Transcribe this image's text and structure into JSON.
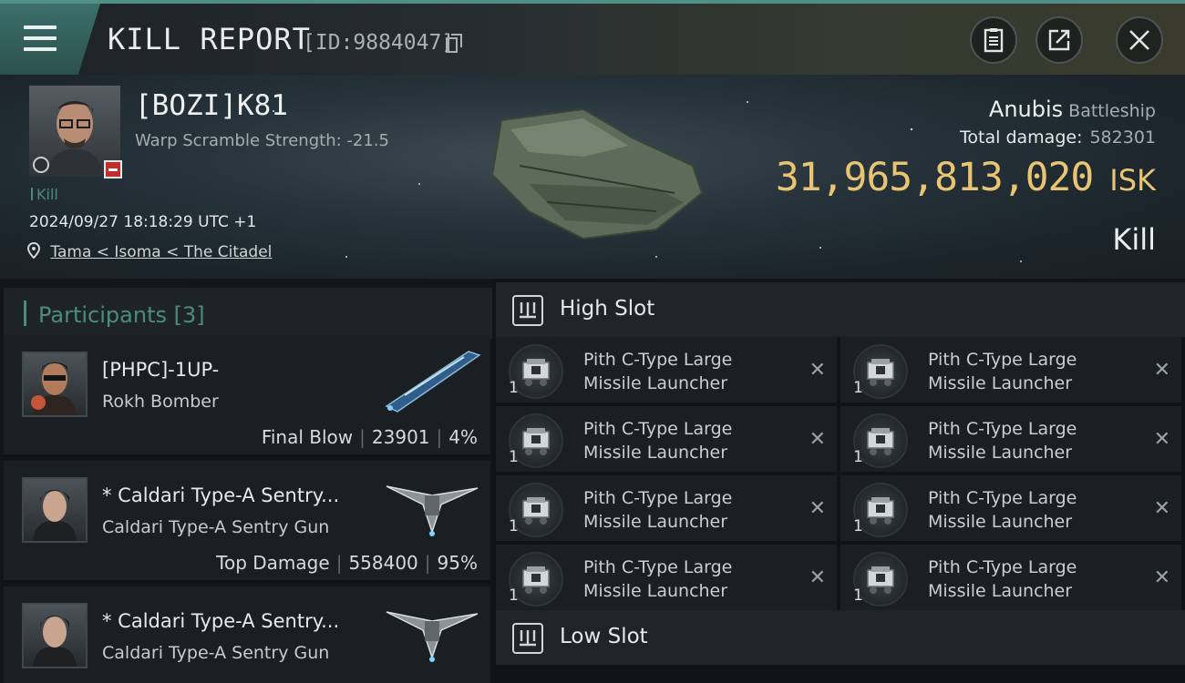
{
  "header": {
    "title": "KILL REPORT",
    "kill_id": "[ID:9884047]",
    "icons": [
      "menu-icon",
      "copy-icon",
      "clipboard-icon",
      "share-icon",
      "close-icon"
    ]
  },
  "victim": {
    "name": "[BOZI]K81",
    "warp_scramble": "Warp Scramble Strength: -21.5",
    "tag": "Kill",
    "datetime": "2024/09/27 18:18:29 UTC +1",
    "location": "Tama < Isoma < The Citadel",
    "ship_name": "Anubis",
    "ship_class": "Battleship",
    "total_damage_label": "Total damage:",
    "total_damage": "582301",
    "isk_value": "31,965,813,020",
    "isk_unit": "ISK",
    "result": "Kill"
  },
  "participants": {
    "title": "Participants [3]",
    "list": [
      {
        "name": "[PHPC]-1UP-",
        "ship": "Rokh Bomber",
        "role": "Final Blow",
        "damage": "23901",
        "percent": "4%"
      },
      {
        "name": "* Caldari Type-A Sentry...",
        "ship": "Caldari Type-A Sentry Gun",
        "role": "Top Damage",
        "damage": "558400",
        "percent": "95%"
      },
      {
        "name": "* Caldari Type-A Sentry...",
        "ship": "Caldari Type-A Sentry Gun",
        "role": "",
        "damage": "",
        "percent": ""
      }
    ]
  },
  "fitting": {
    "high_slot_title": "High Slot",
    "low_slot_title": "Low Slot",
    "modules": [
      {
        "line1": "Pith C-Type Large",
        "line2": "Missile Launcher",
        "qty": "1"
      },
      {
        "line1": "Pith C-Type Large",
        "line2": "Missile Launcher",
        "qty": "1"
      },
      {
        "line1": "Pith C-Type Large",
        "line2": "Missile Launcher",
        "qty": "1"
      },
      {
        "line1": "Pith C-Type Large",
        "line2": "Missile Launcher",
        "qty": "1"
      },
      {
        "line1": "Pith C-Type Large",
        "line2": "Missile Launcher",
        "qty": "1"
      },
      {
        "line1": "Pith C-Type Large",
        "line2": "Missile Launcher",
        "qty": "1"
      },
      {
        "line1": "Pith C-Type Large",
        "line2": "Missile Launcher",
        "qty": "1"
      },
      {
        "line1": "Pith C-Type Large",
        "line2": "Missile Launcher",
        "qty": "1"
      }
    ],
    "remove_symbol": "✕"
  },
  "colors": {
    "accent_teal": "#4d8b82",
    "isk_gold": "#e8c474",
    "minus_red": "#c22d2d"
  }
}
